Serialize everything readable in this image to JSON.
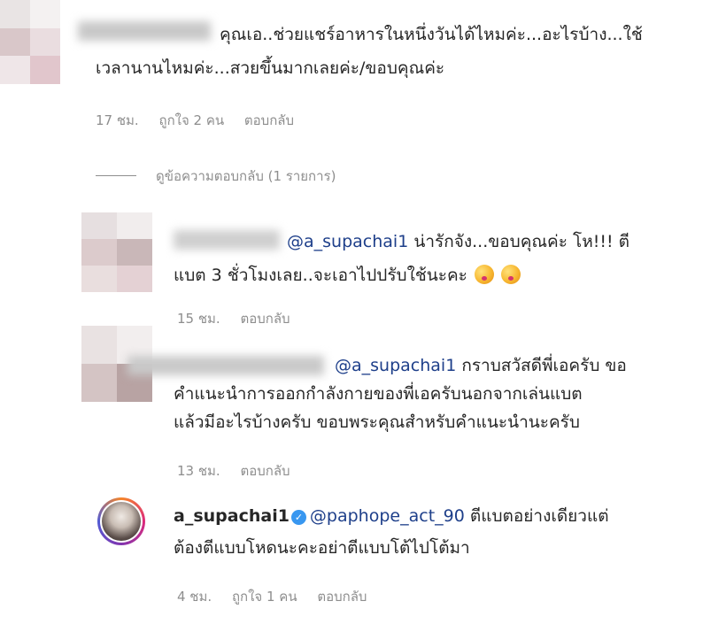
{
  "comments": [
    {
      "text_line1": "คุณเอ..ช่วยแชร์อาหารในหนึ่งวันได้ไหมค่ะ...อะไรบ้าง...ใช้",
      "text_line2": "เวลานานไหมค่ะ...สวยขึ้นมากเลยค่ะ/ขอบคุณค่ะ",
      "time": "17 ชม.",
      "likes": "ถูกใจ 2 คน",
      "reply": "ตอบกลับ"
    }
  ],
  "view_replies": "ดูข้อความตอบกลับ (1 รายการ)",
  "replies": [
    {
      "mention": "@a_supachai1",
      "text_line1": " น่ารักจัง...ขอบคุณค่ะ โห!!! ตี",
      "text_line2": "แบต 3 ชั่วโมงเลย..จะเอาไปปรับใช้นะคะ",
      "time": "15 ชม.",
      "reply": "ตอบกลับ"
    },
    {
      "mention": "@a_supachai1",
      "text_line1": " กราบสวัสดีพี่เอครับ ขอ",
      "text_line2": "คำแนะนำการออกกำลังกายของพี่เอครับนอกจากเล่นแบต",
      "text_line3": "แล้วมีอะไรบ้างครับ ขอบพระคุณสำหรับคำแนะนำนะครับ",
      "time": "13 ชม.",
      "reply": "ตอบกลับ"
    },
    {
      "username": "a_supachai1",
      "verified_icon": "check-icon",
      "mention": "@paphope_act_90",
      "text_line1": " ตีแบตอย่างเดียวแต่",
      "text_line2": "ต้องตีแบบโหดนะคะอย่าตีแบบโต้ไปโต้มา",
      "time": "4 ชม.",
      "likes": "ถูกใจ 1 คน",
      "reply": "ตอบกลับ"
    }
  ],
  "colors": {
    "mention": "#1e3f8a",
    "meta": "#8e8e8e",
    "verified": "#3897f0"
  }
}
